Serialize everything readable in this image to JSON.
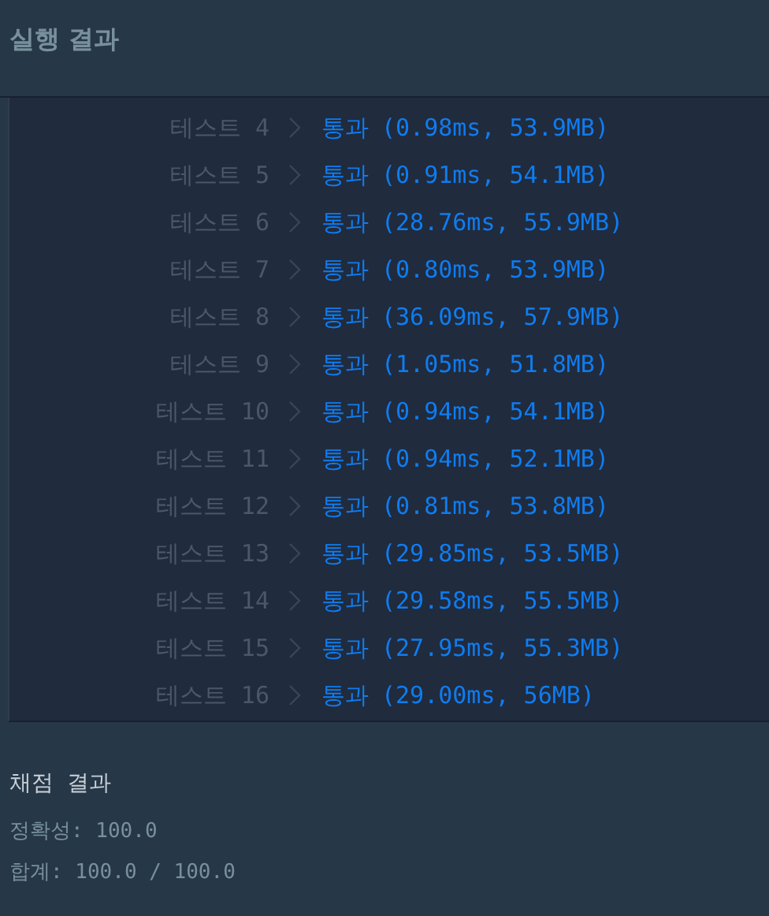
{
  "header": {
    "title": "실행 결과"
  },
  "tests": [
    {
      "label": "테스트 4",
      "result": "통과",
      "detail": "(0.98ms, 53.9MB)",
      "passed": true
    },
    {
      "label": "테스트 5",
      "result": "통과",
      "detail": "(0.91ms, 54.1MB)",
      "passed": true
    },
    {
      "label": "테스트 6",
      "result": "통과",
      "detail": "(28.76ms, 55.9MB)",
      "passed": true
    },
    {
      "label": "테스트 7",
      "result": "통과",
      "detail": "(0.80ms, 53.9MB)",
      "passed": true
    },
    {
      "label": "테스트 8",
      "result": "통과",
      "detail": "(36.09ms, 57.9MB)",
      "passed": true
    },
    {
      "label": "테스트 9",
      "result": "통과",
      "detail": "(1.05ms, 51.8MB)",
      "passed": true
    },
    {
      "label": "테스트 10",
      "result": "통과",
      "detail": "(0.94ms, 54.1MB)",
      "passed": true
    },
    {
      "label": "테스트 11",
      "result": "통과",
      "detail": "(0.94ms, 52.1MB)",
      "passed": true
    },
    {
      "label": "테스트 12",
      "result": "통과",
      "detail": "(0.81ms, 53.8MB)",
      "passed": true
    },
    {
      "label": "테스트 13",
      "result": "통과",
      "detail": "(29.85ms, 53.5MB)",
      "passed": true
    },
    {
      "label": "테스트 14",
      "result": "통과",
      "detail": "(29.58ms, 55.5MB)",
      "passed": true
    },
    {
      "label": "테스트 15",
      "result": "통과",
      "detail": "(27.95ms, 55.3MB)",
      "passed": true
    },
    {
      "label": "테스트 16",
      "result": "통과",
      "detail": "(29.00ms, 56MB)",
      "passed": true
    }
  ],
  "grading": {
    "title": "채점 결과",
    "lines": [
      "정확성: 100.0",
      "합계: 100.0 / 100.0"
    ]
  }
}
